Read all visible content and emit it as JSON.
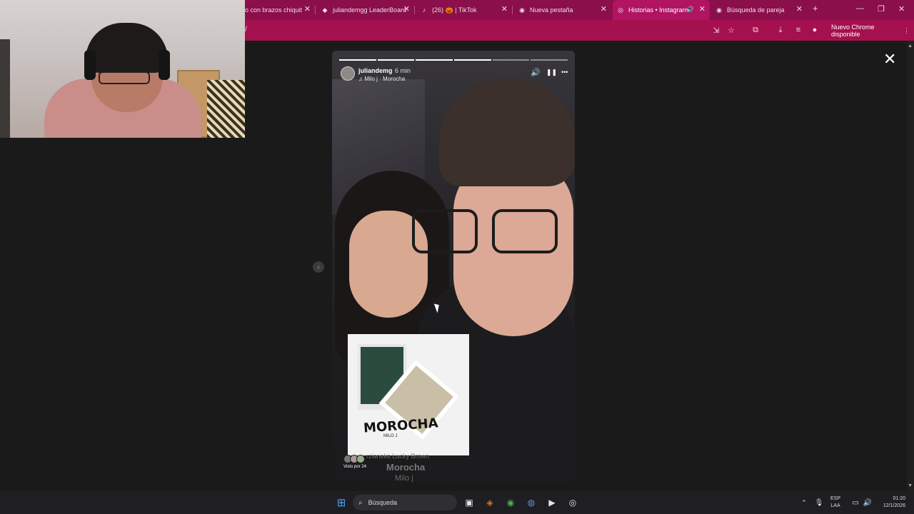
{
  "browser": {
    "tabs": [
      {
        "label": "o con brazos chiquit",
        "icon": "generic-favicon"
      },
      {
        "label": "juliandemgg LeaderBoard",
        "icon": "leaderboard-favicon"
      },
      {
        "label": "(26) 🎃 | TikTok",
        "icon": "tiktok-favicon"
      },
      {
        "label": "Nueva pestaña",
        "icon": "chrome-favicon"
      },
      {
        "label": "Historias • Instagram",
        "icon": "instagram-favicon",
        "active": true
      },
      {
        "label": "Búsqueda de pareja",
        "icon": "chrome-favicon"
      }
    ],
    "close_glyph": "✕",
    "new_tab_glyph": "+",
    "minimize_glyph": "—",
    "restore_glyph": "❐",
    "window_close_glyph": "✕",
    "address_fragment": "/",
    "update_label": "Nuevo Chrome disponible",
    "menu_glyph": "⋮"
  },
  "story": {
    "username": "juliandemg",
    "time_ago": "6 min",
    "song": "Milo j · Morocha",
    "segments": 6,
    "segments_done": 4,
    "sticker_title": "MOROCHA",
    "sticker_sub": "MILO J",
    "viewers_label": "Visto por 24",
    "ghost_line1": "rzianeke Lucky Brown",
    "ghost_line2": "Morocha",
    "ghost_line3": "Milo j",
    "close_glyph": "✕",
    "prev_glyph": "‹",
    "more_glyph": "•••",
    "pause_glyph": "❚❚",
    "sound_glyph": "🔊"
  },
  "taskbar": {
    "search_label": "Búsqueda",
    "lang_line1": "ESP",
    "lang_line2": "LAA",
    "time": "01:20",
    "date": "12/1/2026"
  }
}
